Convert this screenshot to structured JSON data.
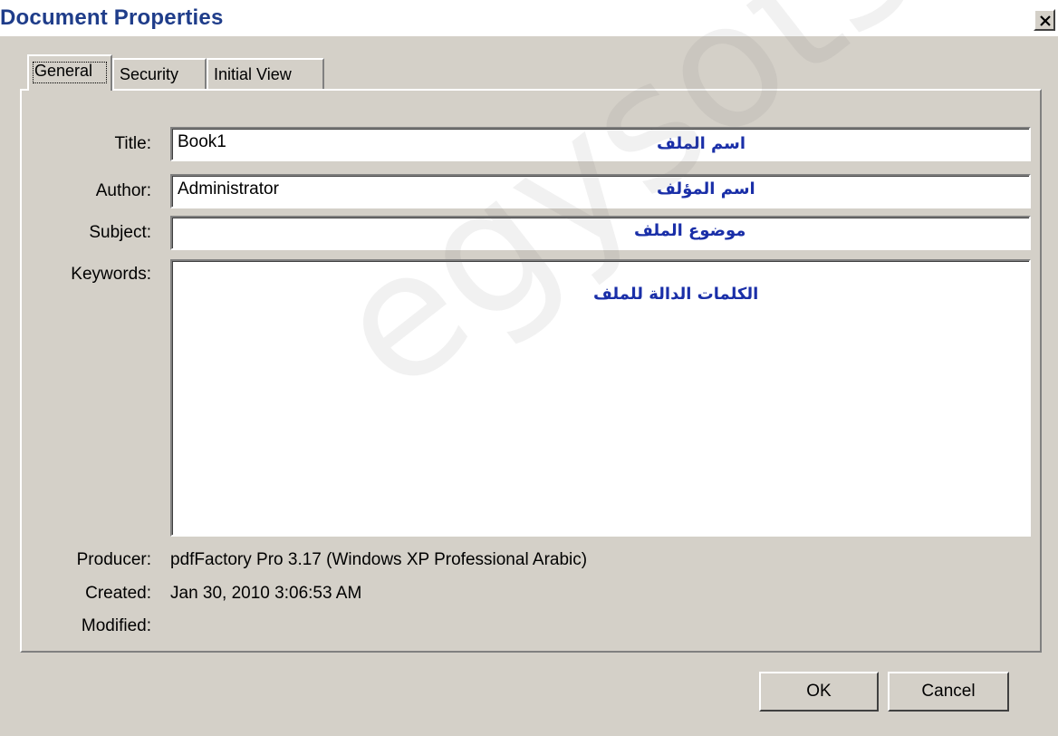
{
  "window": {
    "title": "Document Properties",
    "close_glyph": "×"
  },
  "tabs": [
    {
      "label": "General",
      "active": true
    },
    {
      "label": "Security",
      "active": false
    },
    {
      "label": "Initial View",
      "active": false
    }
  ],
  "fields": {
    "title": {
      "label": "Title:",
      "value": "Book1",
      "annotation": "اسم الملف"
    },
    "author": {
      "label": "Author:",
      "value": "Administrator",
      "annotation": "اسم المؤلف"
    },
    "subject": {
      "label": "Subject:",
      "value": "",
      "annotation": "موضوع الملف"
    },
    "keywords": {
      "label": "Keywords:",
      "value": "",
      "annotation": "الكلمات الدالة للملف"
    }
  },
  "info": {
    "producer": {
      "label": "Producer:",
      "value": "pdfFactory Pro 3.17 (Windows XP Professional Arabic)"
    },
    "created": {
      "label": "Created:",
      "value": "Jan 30, 2010 3:06:53 AM"
    },
    "modified": {
      "label": "Modified:",
      "value": ""
    }
  },
  "buttons": {
    "ok": "OK",
    "cancel": "Cancel"
  },
  "watermark": "egysots.com",
  "colors": {
    "dialog_bg": "#d4d0c8",
    "title_text": "#1f3d8a",
    "annotation_text": "#1a2fa8"
  }
}
